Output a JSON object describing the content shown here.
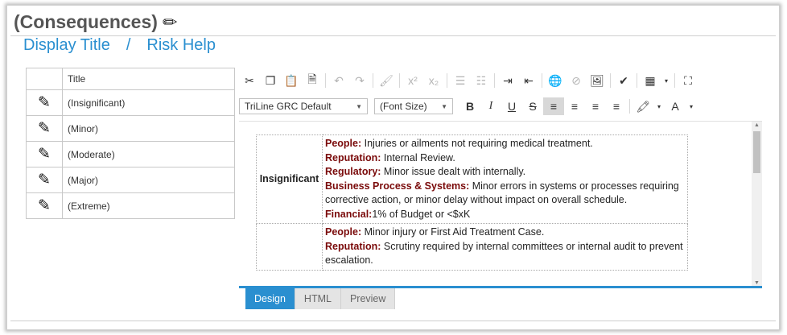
{
  "header": {
    "title": "(Consequences)",
    "edit_icon": "pencil-icon"
  },
  "breadcrumb": {
    "display_title": "Display Title",
    "separator": "/",
    "risk_help": "Risk Help"
  },
  "list": {
    "column_title": "Title",
    "items": [
      {
        "label": "(Insignificant)"
      },
      {
        "label": "(Minor)"
      },
      {
        "label": "(Moderate)"
      },
      {
        "label": "(Major)"
      },
      {
        "label": "(Extreme)"
      }
    ]
  },
  "toolbar": {
    "font_family": "TriLine GRC Default",
    "font_size": "(Font Size)",
    "bold": "B",
    "italic": "I",
    "underline": "U",
    "strike": "S",
    "superscript": "x²",
    "subscript": "x₂"
  },
  "content": {
    "rows": [
      {
        "level": "Insignificant",
        "lines": [
          {
            "key": "People:",
            "text": " Injuries or ailments not requiring medical treatment."
          },
          {
            "key": "Reputation:",
            "text": " Internal Review."
          },
          {
            "key": "Regulatory:",
            "text": " Minor issue dealt with internally."
          },
          {
            "key": "Business Process & Systems:",
            "text": " Minor errors in systems or processes requiring corrective action, or minor delay without impact on overall schedule."
          },
          {
            "key": "Financial:",
            "text": "1% of Budget or <$xK"
          }
        ]
      },
      {
        "level": "",
        "lines": [
          {
            "key": "People:",
            "text": " Minor injury or First Aid Treatment Case."
          },
          {
            "key": "Reputation:",
            "text": " Scrutiny required by internal committees or internal audit to prevent escalation."
          }
        ]
      }
    ]
  },
  "tabs": [
    {
      "label": "Design",
      "active": true
    },
    {
      "label": "HTML",
      "active": false
    },
    {
      "label": "Preview",
      "active": false
    }
  ],
  "colors": {
    "accent": "#2a8fd0",
    "key_text": "#7a0a0a"
  }
}
